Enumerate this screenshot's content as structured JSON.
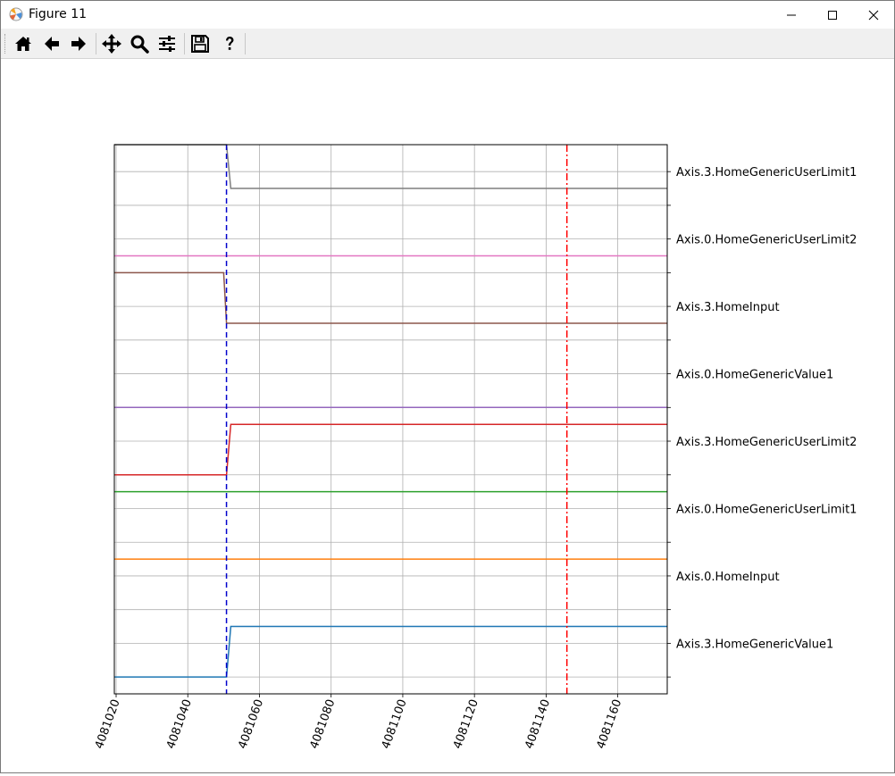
{
  "window": {
    "title": "Figure 11"
  },
  "toolbar": {
    "buttons": [
      {
        "name": "home-button",
        "icon": "home-icon"
      },
      {
        "name": "back-button",
        "icon": "arrow-left-icon"
      },
      {
        "name": "forward-button",
        "icon": "arrow-right-icon"
      },
      {
        "name": "pan-button",
        "icon": "move-icon"
      },
      {
        "name": "zoom-button",
        "icon": "magnifier-icon"
      },
      {
        "name": "configure-subplots-button",
        "icon": "sliders-icon"
      },
      {
        "name": "save-button",
        "icon": "floppy-disk-icon"
      },
      {
        "name": "help-button",
        "icon": "question-icon"
      }
    ]
  },
  "chart_data": {
    "type": "line",
    "title": "",
    "xlabel": "",
    "ylabel": "",
    "grid": true,
    "x_ticks": [
      4081020,
      4081040,
      4081060,
      4081080,
      4081100,
      4081120,
      4081140,
      4081160
    ],
    "x_tick_labels": [
      "4081020",
      "4081040",
      "4081060",
      "4081080",
      "4081100",
      "4081120",
      "4081140",
      "4081160"
    ],
    "xlim": [
      4081019.5,
      4081173.8
    ],
    "ylim": [
      -0.5,
      15.8
    ],
    "y_tick_positions": [
      0,
      1,
      2,
      3,
      4,
      5,
      6,
      7,
      8,
      9,
      10,
      11,
      12,
      13,
      14,
      15
    ],
    "right_labels": [
      {
        "y": 1,
        "text": "Axis.3.HomeGenericValue1"
      },
      {
        "y": 3,
        "text": "Axis.0.HomeInput"
      },
      {
        "y": 5,
        "text": "Axis.0.HomeGenericUserLimit1"
      },
      {
        "y": 7,
        "text": "Axis.3.HomeGenericUserLimit2"
      },
      {
        "y": 9,
        "text": "Axis.0.HomeGenericValue1"
      },
      {
        "y": 11,
        "text": "Axis.3.HomeInput"
      },
      {
        "y": 13,
        "text": "Axis.0.HomeGenericUserLimit2"
      },
      {
        "y": 15,
        "text": "Axis.3.HomeGenericUserLimit1"
      }
    ],
    "series": [
      {
        "color": "#1f77b4",
        "x": [
          4081019.5,
          4081050.8,
          4081052.0,
          4081173.8
        ],
        "y": [
          -0.0,
          -0.0,
          1.5,
          1.5
        ]
      },
      {
        "color": "#ff7f0e",
        "x": [
          4081019.5,
          4081173.8
        ],
        "y": [
          3.5,
          3.5
        ]
      },
      {
        "color": "#2ca02c",
        "x": [
          4081019.5,
          4081173.8
        ],
        "y": [
          5.5,
          5.5
        ]
      },
      {
        "color": "#d62728",
        "x": [
          4081019.5,
          4081050.8,
          4081052.0,
          4081173.8
        ],
        "y": [
          6.0,
          6.0,
          7.5,
          7.5
        ]
      },
      {
        "color": "#9467bd",
        "x": [
          4081019.5,
          4081173.8
        ],
        "y": [
          8.0,
          8.0
        ]
      },
      {
        "color": "#8c564b",
        "x": [
          4081019.5,
          4081050.0,
          4081050.8,
          4081173.8
        ],
        "y": [
          12.0,
          12.0,
          10.5,
          10.5
        ]
      },
      {
        "color": "#e377c2",
        "x": [
          4081019.5,
          4081173.8
        ],
        "y": [
          12.5,
          12.5
        ]
      },
      {
        "color": "#7f7f7f",
        "x": [
          4081019.5,
          4081050.8,
          4081052.0,
          4081173.8
        ],
        "y": [
          16.0,
          16.0,
          14.5,
          14.5
        ]
      }
    ],
    "vlines": [
      {
        "x": 4081050.8,
        "color": "#0000cc",
        "style": "dashed"
      },
      {
        "x": 4081145.8,
        "color": "#ff0000",
        "style": "dashdot"
      }
    ]
  }
}
